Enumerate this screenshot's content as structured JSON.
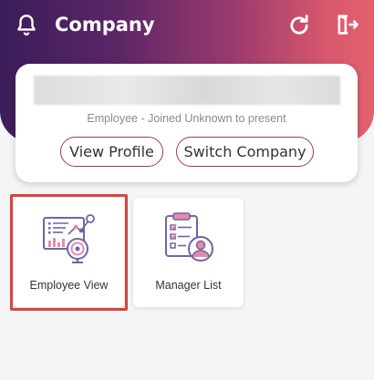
{
  "header": {
    "title": "Company",
    "icons": [
      "bell-icon",
      "refresh-icon",
      "logout-icon"
    ],
    "gradient": [
      "#3a1d5a",
      "#9a3a6e",
      "#e2626e"
    ]
  },
  "profile_card": {
    "subtitle": "Employee - Joined Unknown to present",
    "view_profile_label": "View Profile",
    "switch_company_label": "Switch Company"
  },
  "tiles": [
    {
      "label": "Employee View",
      "icon": "employee-analytics-icon",
      "selected": true
    },
    {
      "label": "Manager List",
      "icon": "checklist-user-icon",
      "selected": false
    }
  ],
  "colors": {
    "accent": "#9a3a66",
    "highlight": "#d9443f",
    "icon_purple": "#7063a8",
    "icon_pink": "#e88aa5"
  }
}
